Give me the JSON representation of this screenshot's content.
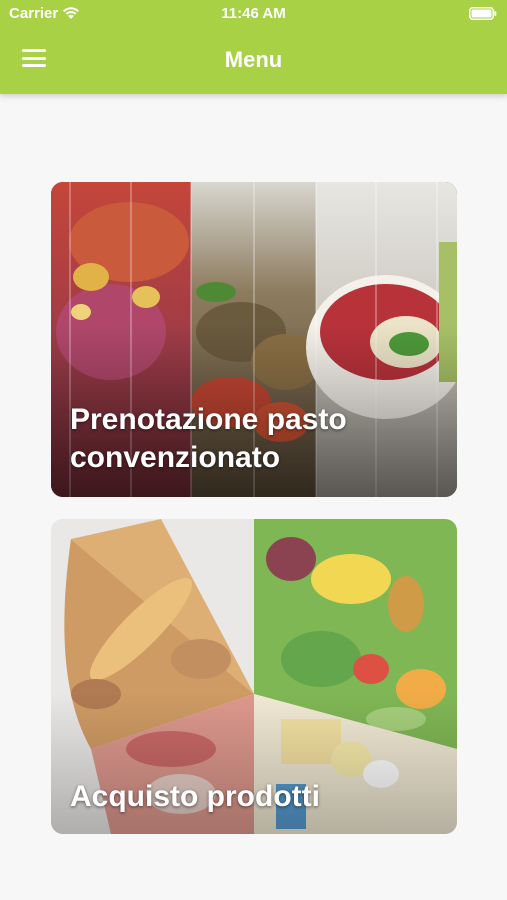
{
  "status_bar": {
    "carrier": "Carrier",
    "time": "11:46 AM",
    "wifi_icon": "wifi-icon",
    "battery_icon": "battery-icon"
  },
  "header": {
    "title": "Menu",
    "menu_icon": "hamburger-menu-icon",
    "background_color": "#a8d146"
  },
  "cards": [
    {
      "label_line1": "Prenotazione pasto",
      "label_line2": "convenzionato",
      "image": "meal-photo-collage"
    },
    {
      "label": "Acquisto prodotti",
      "image": "food-groups-wheel-photo"
    }
  ]
}
